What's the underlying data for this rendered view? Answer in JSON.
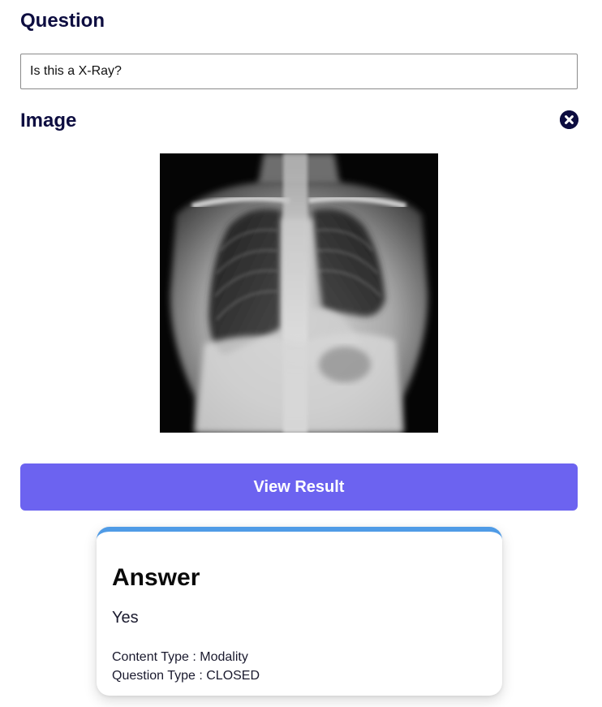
{
  "question": {
    "title": "Question",
    "input_value": "Is this a X-Ray?"
  },
  "image_section": {
    "title": "Image",
    "remove_icon": "close-circle-icon"
  },
  "view_result": {
    "label": "View Result",
    "color": "#6c63f0"
  },
  "answer": {
    "heading": "Answer",
    "value": "Yes",
    "content_type_label": "Content Type",
    "content_type_value": "Modality",
    "question_type_label": "Question Type",
    "question_type_value": "CLOSED",
    "accent_color": "#4f9be6"
  }
}
